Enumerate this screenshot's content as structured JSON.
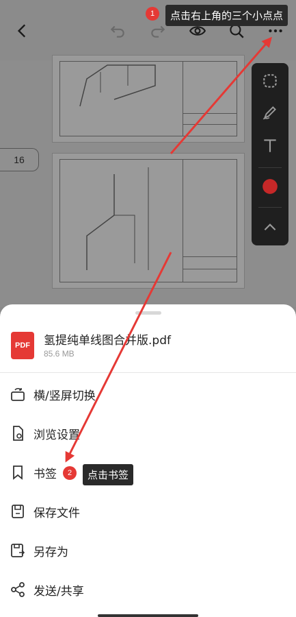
{
  "toolbar": {
    "icons": [
      "back-icon",
      "undo-icon",
      "redo-icon",
      "eye-icon",
      "search-icon",
      "more-icon"
    ]
  },
  "viewer": {
    "page_number": "16"
  },
  "palette": {
    "icons": [
      "shape-icon",
      "pen-icon",
      "text-icon",
      "color-dot-icon",
      "collapse-icon"
    ],
    "accent_color": "#d32f2f"
  },
  "sheet": {
    "file_name": "氢提纯单线图合并版.pdf",
    "file_size": "85.6 MB",
    "file_badge": "PDF",
    "menu": [
      {
        "label": "横/竖屏切换",
        "icon": "rotate-screen-icon"
      },
      {
        "label": "浏览设置",
        "icon": "browse-settings-icon"
      },
      {
        "label": "书签",
        "icon": "bookmark-icon"
      },
      {
        "label": "保存文件",
        "icon": "save-icon"
      },
      {
        "label": "另存为",
        "icon": "save-as-icon"
      },
      {
        "label": "发送/共享",
        "icon": "share-icon"
      }
    ]
  },
  "annotations": {
    "step1_number": "1",
    "step1_text": "点击右上角的三个小点点",
    "step2_number": "2",
    "step2_text": "点击书签",
    "marker_color": "#e53935"
  }
}
